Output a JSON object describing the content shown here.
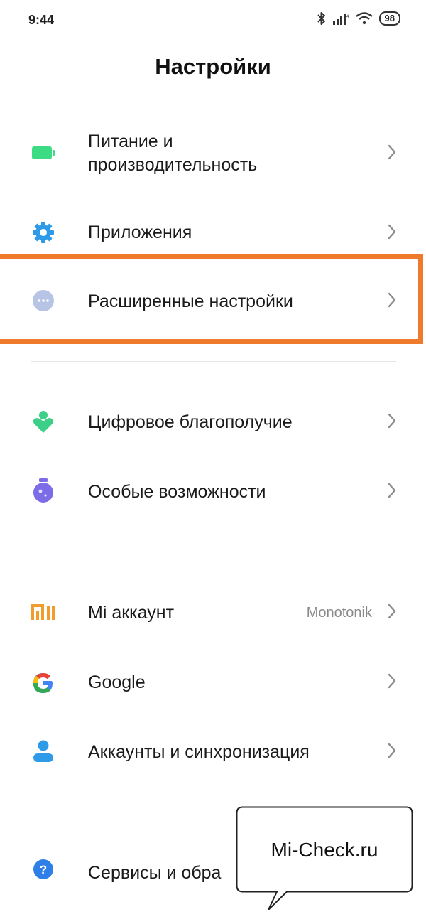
{
  "status_bar": {
    "time": "9:44",
    "battery": "98",
    "icons": [
      "bluetooth-icon",
      "signal-icon",
      "wifi-icon",
      "battery-icon"
    ]
  },
  "title": "Настройки",
  "colors": {
    "highlight": "#f07a2c",
    "power_icon": "#3ddc84",
    "apps_icon": "#2f9be8",
    "more_icon": "#b7c4e6",
    "wellbeing_icon": "#3ccf87",
    "accessibility_icon": "#7c6ce8",
    "mi_icon": "#f39c2e",
    "accounts_icon": "#2f9be8",
    "services_icon": "#2f7fe8",
    "value_text": "#8a8a8a"
  },
  "items": [
    {
      "label_line1": "Питание и",
      "label_line2": "производительность",
      "icon": "battery-icon"
    },
    {
      "label": "Приложения",
      "icon": "gear-icon"
    },
    {
      "label": "Расширенные настройки",
      "icon": "more-dots-icon"
    },
    {
      "label": "Цифровое благополучие",
      "icon": "heart-person-icon"
    },
    {
      "label": "Особые возможности",
      "icon": "flask-icon"
    },
    {
      "label": "Mi аккаунт",
      "value": "Monotonik",
      "icon": "mi-logo-icon"
    },
    {
      "label": "Google",
      "icon": "google-icon"
    },
    {
      "label": "Аккаунты и синхронизация",
      "icon": "person-icon"
    },
    {
      "label": "Сервисы и обра",
      "icon": "question-icon"
    }
  ],
  "watermark": "Mi-Check.ru"
}
